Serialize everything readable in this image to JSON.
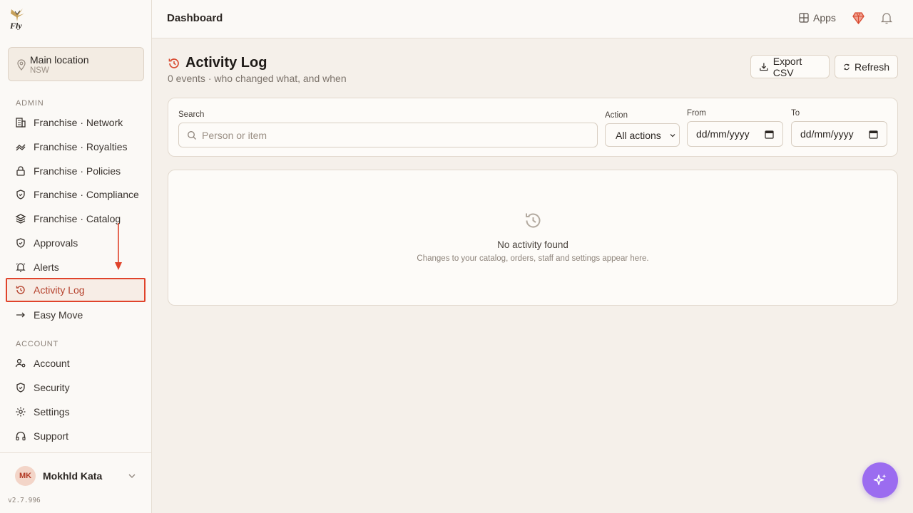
{
  "brand": {
    "logo_text": "Fly"
  },
  "location": {
    "name": "Main location",
    "region": "NSW"
  },
  "sidebar": {
    "admin_title": "ADMIN",
    "admin_items": [
      {
        "label": "Franchise · Network",
        "icon": "building-icon"
      },
      {
        "label": "Franchise · Royalties",
        "icon": "coins-icon"
      },
      {
        "label": "Franchise · Policies",
        "icon": "lock-icon"
      },
      {
        "label": "Franchise · Compliance",
        "icon": "shield-check-icon"
      },
      {
        "label": "Franchise · Catalog",
        "icon": "layers-icon"
      },
      {
        "label": "Approvals",
        "icon": "shield-check-icon"
      },
      {
        "label": "Alerts",
        "icon": "bell-ring-icon"
      },
      {
        "label": "Activity Log",
        "icon": "history-icon",
        "active": true
      },
      {
        "label": "Easy Move",
        "icon": "arrow-right-icon"
      }
    ],
    "account_title": "ACCOUNT",
    "account_items": [
      {
        "label": "Account",
        "icon": "user-cog-icon"
      },
      {
        "label": "Security",
        "icon": "shield-icon"
      },
      {
        "label": "Settings",
        "icon": "gear-icon"
      },
      {
        "label": "Support",
        "icon": "headphones-icon"
      }
    ]
  },
  "user": {
    "initials": "MK",
    "name": "Mokhld Kata"
  },
  "version": "v2.7.996",
  "topbar": {
    "title": "Dashboard",
    "apps_label": "Apps"
  },
  "page": {
    "title": "Activity Log",
    "subtitle": "0 events · who changed what, and when",
    "export_label": "Export CSV",
    "refresh_label": "Refresh"
  },
  "filters": {
    "search_label": "Search",
    "search_placeholder": "Person or item",
    "action_label": "Action",
    "action_value": "All actions",
    "from_label": "From",
    "from_value": "dd/mm/yyyy",
    "to_label": "To",
    "to_value": "dd/mm/yyyy"
  },
  "empty": {
    "title": "No activity found",
    "subtitle": "Changes to your catalog, orders, staff and settings appear here."
  },
  "colors": {
    "accent": "#e0432b",
    "active_text": "#b5412c",
    "fab": "#9b6cf0",
    "background": "#f5f0ea"
  }
}
